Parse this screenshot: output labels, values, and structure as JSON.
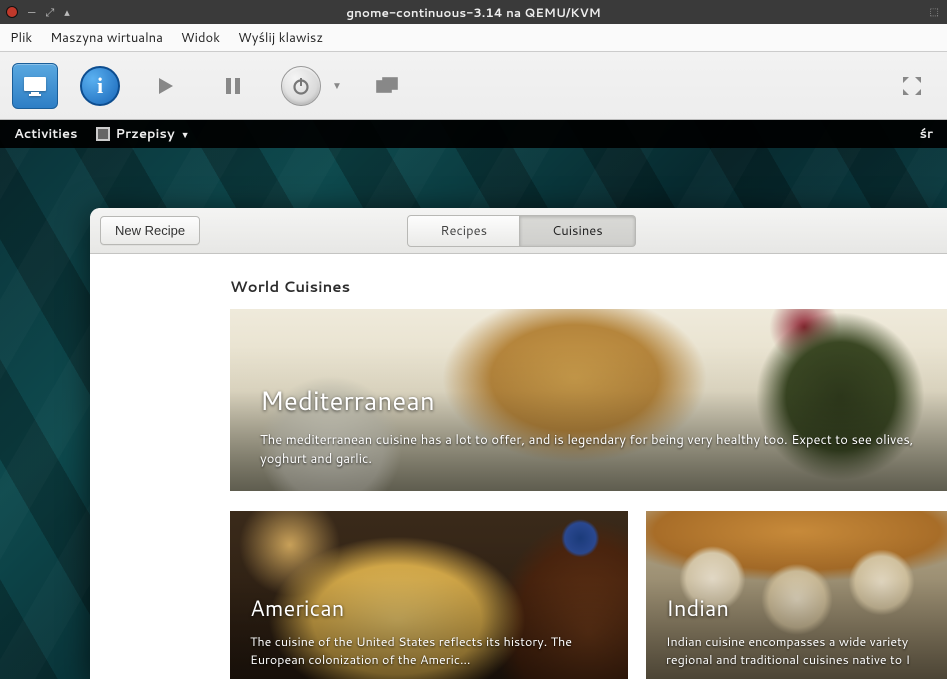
{
  "vm": {
    "title": "gnome-continuous-3.14 na QEMU/KVM",
    "menu": {
      "file": "Plik",
      "machine": "Maszyna wirtualna",
      "view": "Widok",
      "sendkey": "Wyślij klawisz"
    }
  },
  "gnome": {
    "activities": "Activities",
    "app_name": "Przepisy",
    "clock": "śr"
  },
  "recipes": {
    "new_recipe": "New Recipe",
    "tabs": {
      "recipes": "Recipes",
      "cuisines": "Cuisines"
    },
    "active_tab": "cuisines",
    "section_title": "World Cuisines",
    "hero": {
      "title": "Mediterranean",
      "desc": "The mediterranean cuisine has a lot to offer, and is legendary for being very healthy too. Expect to see olives, yoghurt and garlic."
    },
    "cards": [
      {
        "key": "american",
        "title": "American",
        "desc": "The cuisine of the United States reflects its history. The European colonization of the Americ…"
      },
      {
        "key": "indian",
        "title": "Indian",
        "desc": "Indian cuisine encompasses a wide variety regional and traditional cuisines native to I"
      }
    ]
  }
}
